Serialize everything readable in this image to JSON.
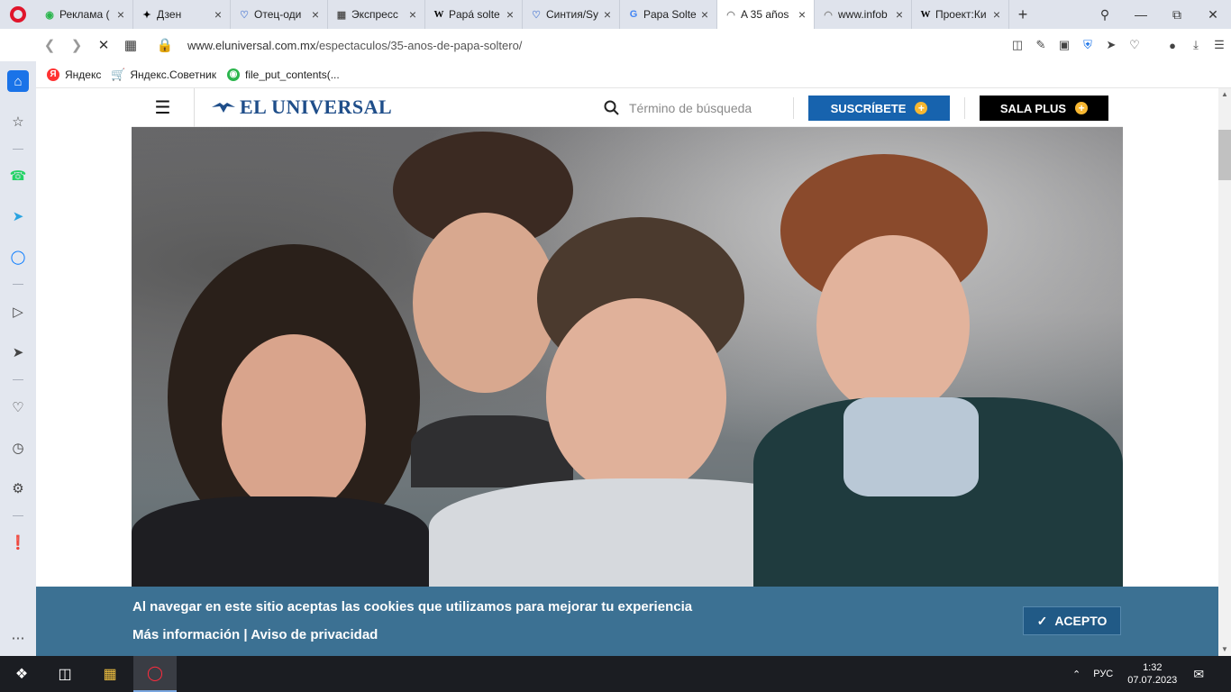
{
  "tabs": [
    {
      "label": "Реклама (",
      "icon": "green-chat-icon"
    },
    {
      "label": "Дзен",
      "icon": "dzen-icon"
    },
    {
      "label": "Отец-оди",
      "icon": "heart-icon"
    },
    {
      "label": "Экспресс",
      "icon": "grid-icon"
    },
    {
      "label": "Papá solte",
      "icon": "wikipedia-icon"
    },
    {
      "label": "Синтия/Sy",
      "icon": "heart-icon"
    },
    {
      "label": "Papa Solte",
      "icon": "google-icon"
    },
    {
      "label": "A 35 años",
      "icon": "loading-icon",
      "active": true
    },
    {
      "label": "www.infob",
      "icon": "loading-icon"
    },
    {
      "label": "Проект:Ки",
      "icon": "wikipedia-icon"
    }
  ],
  "address": {
    "domain": "www.eluniversal.com.mx",
    "path": "/espectaculos/35-anos-de-papa-soltero/"
  },
  "bookmarks": [
    {
      "label": "Яндекс",
      "color": "#f33"
    },
    {
      "label": "Яндекс.Советник",
      "color": "#333"
    },
    {
      "label": "file_put_contents(...",
      "color": "#2bb54d"
    }
  ],
  "site": {
    "logo": "EL UNIVERSAL",
    "search_placeholder": "Término de búsqueda",
    "subscribe_label": "SUSCRÍBETE",
    "sala_label": "SALA PLUS"
  },
  "cookie": {
    "message": "Al navegar en este sitio aceptas las cookies que utilizamos para mejorar tu experiencia",
    "more_info": "Más información",
    "separator": "|",
    "privacy": "Aviso de privacidad",
    "accept": "ACEPTO"
  },
  "taskbar": {
    "lang": "РУС",
    "time": "1:32",
    "date": "07.07.2023"
  },
  "colors": {
    "brand_blue": "#1763ae",
    "cookie_bg": "#3c7193",
    "opera_red": "#e0152b"
  }
}
